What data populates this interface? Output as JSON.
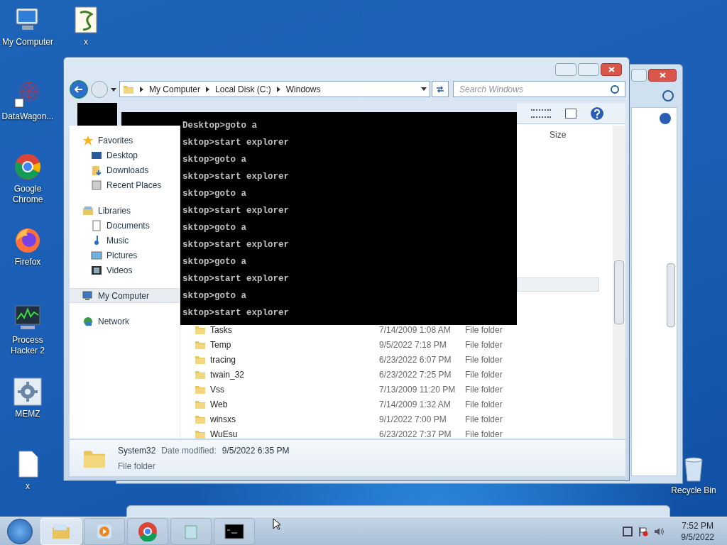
{
  "desktop_icons": [
    {
      "label": "My Computer",
      "kind": "computer"
    },
    {
      "label": "x",
      "kind": "script"
    },
    {
      "label": "DataWagon...",
      "kind": "web"
    },
    {
      "label": "Google Chrome",
      "kind": "chrome"
    },
    {
      "label": "Firefox",
      "kind": "firefox"
    },
    {
      "label": "Process Hacker 2",
      "kind": "monitor"
    },
    {
      "label": "MEMZ",
      "kind": "gear"
    },
    {
      "label": "x",
      "kind": "file"
    },
    {
      "label": "Recycle Bin",
      "kind": "bin"
    }
  ],
  "explorer": {
    "breadcrumb": [
      "My Computer",
      "Local Disk (C:)",
      "Windows"
    ],
    "search": {
      "placeholder": "Search Windows"
    },
    "nav_pane": [
      {
        "label": "Favorites",
        "kind": "star",
        "selected": false,
        "children": [
          {
            "label": "Desktop",
            "kind": "desktop",
            "selected": false
          },
          {
            "label": "Downloads",
            "kind": "download",
            "selected": false
          },
          {
            "label": "Recent Places",
            "kind": "recent",
            "selected": false
          }
        ]
      },
      {
        "label": "Libraries",
        "kind": "library",
        "selected": false,
        "children": [
          {
            "label": "Documents",
            "kind": "doc",
            "selected": false
          },
          {
            "label": "Music",
            "kind": "music",
            "selected": false
          },
          {
            "label": "Pictures",
            "kind": "picture",
            "selected": false
          },
          {
            "label": "Videos",
            "kind": "video",
            "selected": false
          }
        ]
      },
      {
        "label": "My Computer",
        "kind": "computer",
        "selected": true
      },
      {
        "label": "Network",
        "kind": "network",
        "selected": false
      }
    ],
    "column_header": "Size",
    "files": [
      {
        "name": "Tasks",
        "modified": "7/14/2009 1:08 AM",
        "type": "File folder"
      },
      {
        "name": "Temp",
        "modified": "9/5/2022 7:18 PM",
        "type": "File folder"
      },
      {
        "name": "tracing",
        "modified": "6/23/2022 6:07 PM",
        "type": "File folder"
      },
      {
        "name": "twain_32",
        "modified": "6/23/2022 7:25 PM",
        "type": "File folder"
      },
      {
        "name": "Vss",
        "modified": "7/13/2009 11:20 PM",
        "type": "File folder"
      },
      {
        "name": "Web",
        "modified": "7/14/2009 1:32 AM",
        "type": "File folder"
      },
      {
        "name": "winsxs",
        "modified": "9/1/2022 7:00 PM",
        "type": "File folder"
      },
      {
        "name": "WuEsu",
        "modified": "6/23/2022 7:37 PM",
        "type": "File folder"
      }
    ],
    "details": {
      "name": "System32",
      "modified_label": "Date modified:",
      "modified": "9/5/2022 6:35 PM",
      "type": "File folder"
    }
  },
  "console_lines": [
    "Desktop>goto a",
    "sktop>start explorer",
    "sktop>goto a",
    "sktop>start explorer",
    "sktop>goto a",
    "sktop>start explorer",
    "sktop>goto a",
    "sktop>start explorer",
    "sktop>goto a",
    "sktop>start explorer",
    "sktop>goto a",
    "sktop>start explorer"
  ],
  "taskbar": {
    "apps": [
      {
        "kind": "explorer",
        "selected": true
      },
      {
        "kind": "media",
        "selected": false
      },
      {
        "kind": "chrome",
        "selected": false
      },
      {
        "kind": "notepad",
        "selected": false
      },
      {
        "kind": "console",
        "selected": false
      }
    ],
    "time": "7:52 PM",
    "date": "9/5/2022"
  }
}
